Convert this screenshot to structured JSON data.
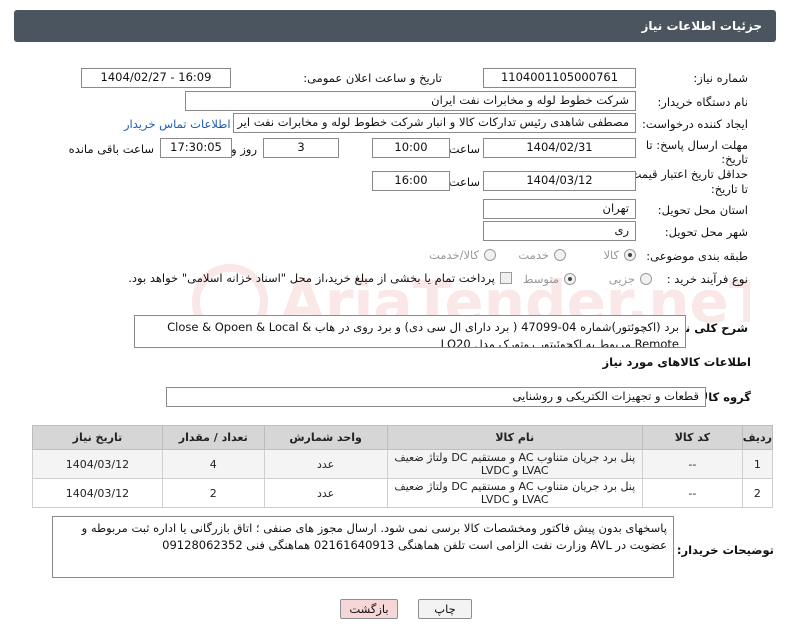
{
  "header": {
    "title": "جزئیات اطلاعات نیاز"
  },
  "form": {
    "need_number": {
      "label": "شماره نیاز:",
      "value": "1104001105000761"
    },
    "announce_date": {
      "label": "تاریخ و ساعت اعلان عمومی:",
      "value": "1404/02/27 - 16:09"
    },
    "buyer_org": {
      "label": "نام دستگاه خریدار:",
      "value": "شرکت خطوط لوله و مخابرات نفت ایران"
    },
    "requester": {
      "label": "ایجاد کننده درخواست:",
      "value": "مصطفی  شاهدی رئیس تدارکات کالا و انبار شرکت خطوط لوله و مخابرات نفت ایر",
      "contact_link": "اطلاعات تماس خریدار"
    },
    "send_deadline": {
      "label_line1": "مهلت ارسال پاسخ: تا",
      "label_line2": "تاریخ:",
      "date": "1404/02/31",
      "time_label": "ساعت",
      "time": "10:00",
      "days": "3",
      "days_label": "روز و",
      "remaining": "17:30:05",
      "remaining_label": "ساعت باقی مانده"
    },
    "price_deadline": {
      "label_line1": "حداقل تاریخ اعتبار قیمت:",
      "label_line2": "تا تاریخ:",
      "date": "1404/03/12",
      "time_label": "ساعت",
      "time": "16:00"
    },
    "province": {
      "label": "استان محل تحویل:",
      "value": "تهران"
    },
    "city": {
      "label": "شهر محل تحویل:",
      "value": "ری"
    },
    "category": {
      "label": "طبقه بندی موضوعی:",
      "options": [
        "کالا",
        "خدمت",
        "کالا/خدمت"
      ]
    },
    "process": {
      "label": "نوع فرآیند خرید :",
      "options": [
        "جزیی",
        "متوسط"
      ],
      "treasury_note": "پرداخت تمام یا بخشی از مبلغ خرید،از محل \"اسناد خزانه اسلامی\" خواهد بود."
    },
    "description": {
      "label": "شرح کلی نیاز:",
      "line1": "برد (اکچوئتور)شماره 04-47099 ( برد دارای ال سی دی) و برد روی در هاب & Close & Opoen & Local",
      "line2": "Remote  مربوط به اکچوئیتور روتورک مدل LQ20"
    }
  },
  "goods": {
    "section_title": "اطلاعات کالاهای مورد نیاز",
    "group_label": "گروه کالا:",
    "group_value": "قطعات و تجهیزات الکتریکی و روشنایی",
    "table": {
      "headers": [
        "ردیف",
        "کد کالا",
        "نام کالا",
        "واحد شمارش",
        "تعداد / مقدار",
        "تاریخ نیاز"
      ],
      "rows": [
        {
          "row": "1",
          "code": "--",
          "name": "پنل برد جریان متناوب AC و مستقیم DC ولتاژ ضعیف LVAC و LVDC",
          "unit": "عدد",
          "qty": "4",
          "date": "1404/03/12"
        },
        {
          "row": "2",
          "code": "--",
          "name": "پنل برد جریان متناوب AC و مستقیم DC ولتاژ ضعیف LVAC و LVDC",
          "unit": "عدد",
          "qty": "2",
          "date": "1404/03/12"
        }
      ]
    }
  },
  "buyer_notes": {
    "label": "توضیحات خریدار:",
    "line1": "پاسخهای بدون پیش فاکتور ومخشصات کالا برسی نمی شود. ارسال مجوز های صنفی ؛ اتاق بازرگانی یا اداره ثبت  مربوطه و",
    "line2": "عضویت در AVL وزارت نفت الزامی است تلفن هماهنگی  02161640913  هماهنگی فنی  09128062352"
  },
  "buttons": {
    "print": "چاپ",
    "back": "بازگشت"
  },
  "colors": {
    "header_bg": "#4a5560",
    "link": "#1a5fb4",
    "back_button": "#f6d6d6"
  }
}
